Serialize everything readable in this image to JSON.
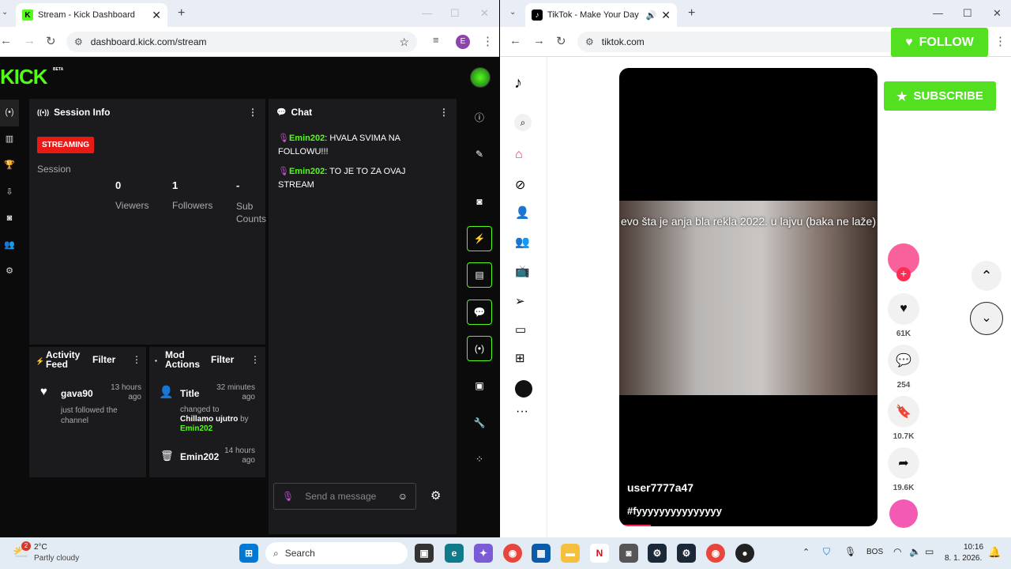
{
  "left": {
    "tab_title": "Stream - Kick Dashboard",
    "url": "dashboard.kick.com/stream",
    "profile_initial": "E",
    "logo": "KICK",
    "logo_badge": "BETA",
    "session": {
      "title": "Session Info",
      "status": "STREAMING",
      "session_label": "Session",
      "stats": [
        {
          "value": "0",
          "label": "Viewers"
        },
        {
          "value": "1",
          "label": "Followers"
        },
        {
          "value": "-",
          "label": "Sub Counts"
        }
      ]
    },
    "chat": {
      "title": "Chat",
      "messages": [
        {
          "user": "Emin202",
          "text": ": HVALA SVIMA NA FOLLOWU!!!"
        },
        {
          "user": "Emin202",
          "text": ": TO JE TO ZA OVAJ STREAM"
        }
      ],
      "placeholder": "Send a message"
    },
    "activity": {
      "title": "Activity Feed",
      "filter": "Filter",
      "user": "gava90",
      "time": "13 hours ago",
      "desc": "just followed the channel"
    },
    "mod": {
      "title": "Mod Actions",
      "filter": "Filter",
      "item1_title": "Title",
      "item1_time": "32 minutes ago",
      "item1_prefix": "changed to",
      "item1_value": "Chillamo ujutro",
      "item1_by": "by",
      "item1_user": "Emin202",
      "item2_user": "Emin202",
      "item2_time": "14 hours ago"
    }
  },
  "right": {
    "tab_title": "TikTok - Make Your Day",
    "url": "tiktok.com",
    "follow_label": "FOLLOW",
    "subscribe_label": "SUBSCRIBE",
    "caption": "evo šta je anja bla rekla 2022. u lajvu (baka ne laže)",
    "username": "user7777a47",
    "hashtag": "#fyyyyyyyyyyyyyyy",
    "likes": "61K",
    "comments": "254",
    "saves": "10.7K",
    "shares": "19.6K"
  },
  "taskbar": {
    "temp": "2°C",
    "weather": "Partly cloudy",
    "weather_badge": "2",
    "search": "Search",
    "lang": "BOS",
    "time": "10:16",
    "date": "8. 1. 2026."
  },
  "colors": {
    "kick_green": "#53fc18",
    "streaming_red": "#e91916",
    "tiktok_pink": "#fe2c55"
  }
}
